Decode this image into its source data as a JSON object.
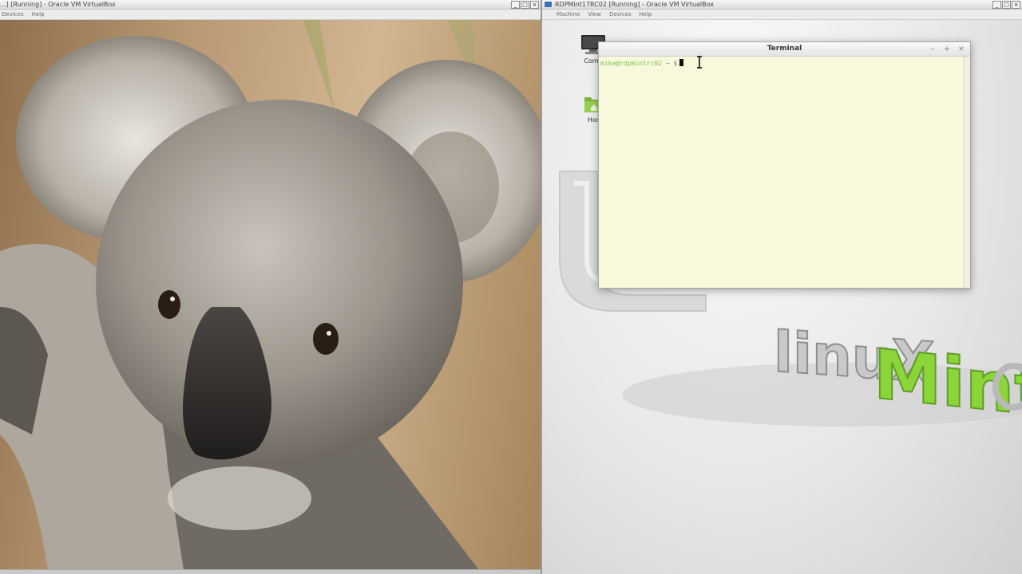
{
  "left_vm": {
    "title": "...] [Running] - Oracle VM VirtualBox",
    "menu": [
      "Devices",
      "Help"
    ],
    "window_buttons": [
      "_",
      "□",
      "×"
    ]
  },
  "right_vm": {
    "title": "RDPMint17RC02 [Running] - Oracle VM VirtualBox",
    "menu": [
      "Machine",
      "View",
      "Devices",
      "Help"
    ],
    "window_buttons": [
      "_",
      "□",
      "×"
    ]
  },
  "desktop": {
    "icons": [
      {
        "label": "Comp",
        "icon": "computer-icon"
      },
      {
        "label": "Hor",
        "icon": "home-folder-icon"
      }
    ],
    "wallpaper_text": "LinuxMint"
  },
  "terminal": {
    "title": "Terminal",
    "prompt_user": "mike@rdpmintrc02",
    "prompt_symbol": "~ $",
    "buttons": [
      "–",
      "+",
      "×"
    ]
  },
  "colors": {
    "mint_green": "#8bd43a",
    "prompt_green": "#7bc64a",
    "terminal_bg": "#f8f8dc"
  }
}
